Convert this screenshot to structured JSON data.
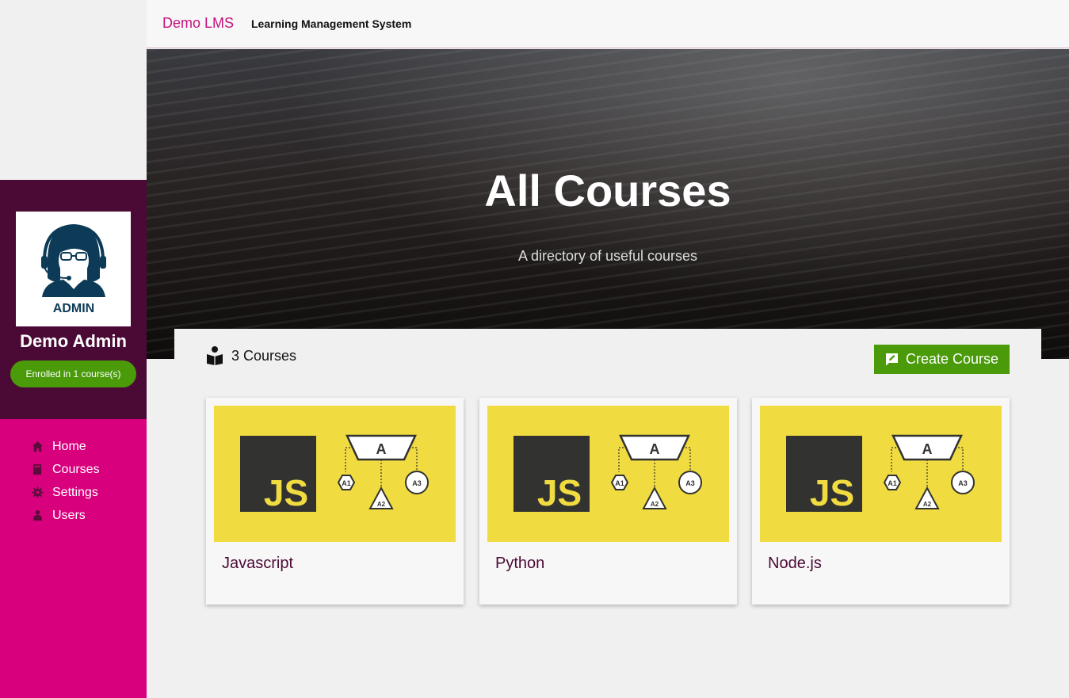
{
  "header": {
    "brand": "Demo LMS",
    "tagline": "Learning Management System"
  },
  "profile": {
    "avatar_label": "ADMIN",
    "name": "Demo Admin",
    "enrolled": "Enrolled in 1 course(s)"
  },
  "nav": {
    "items": [
      {
        "label": "Home",
        "icon": "home-icon"
      },
      {
        "label": "Courses",
        "icon": "book-icon"
      },
      {
        "label": "Settings",
        "icon": "gear-icon"
      },
      {
        "label": "Users",
        "icon": "user-icon"
      }
    ]
  },
  "hero": {
    "title": "All Courses",
    "subtitle": "A directory of useful courses"
  },
  "courses": {
    "count_label": "3 Courses",
    "create_label": "Create Course",
    "items": [
      {
        "title": "Javascript"
      },
      {
        "title": "Python"
      },
      {
        "title": "Node.js"
      }
    ],
    "thumb_text": {
      "logo": "JS",
      "top": "A",
      "left": "A1",
      "middle": "A2",
      "right": "A3"
    }
  },
  "colors": {
    "sidebar_profile_bg": "#4a0a35",
    "sidebar_nav_bg": "#d9007e",
    "accent_green": "#4a9a0a",
    "brand_pink": "#c4117c",
    "thumb_yellow": "#f0db41",
    "thumb_dark": "#323330"
  }
}
